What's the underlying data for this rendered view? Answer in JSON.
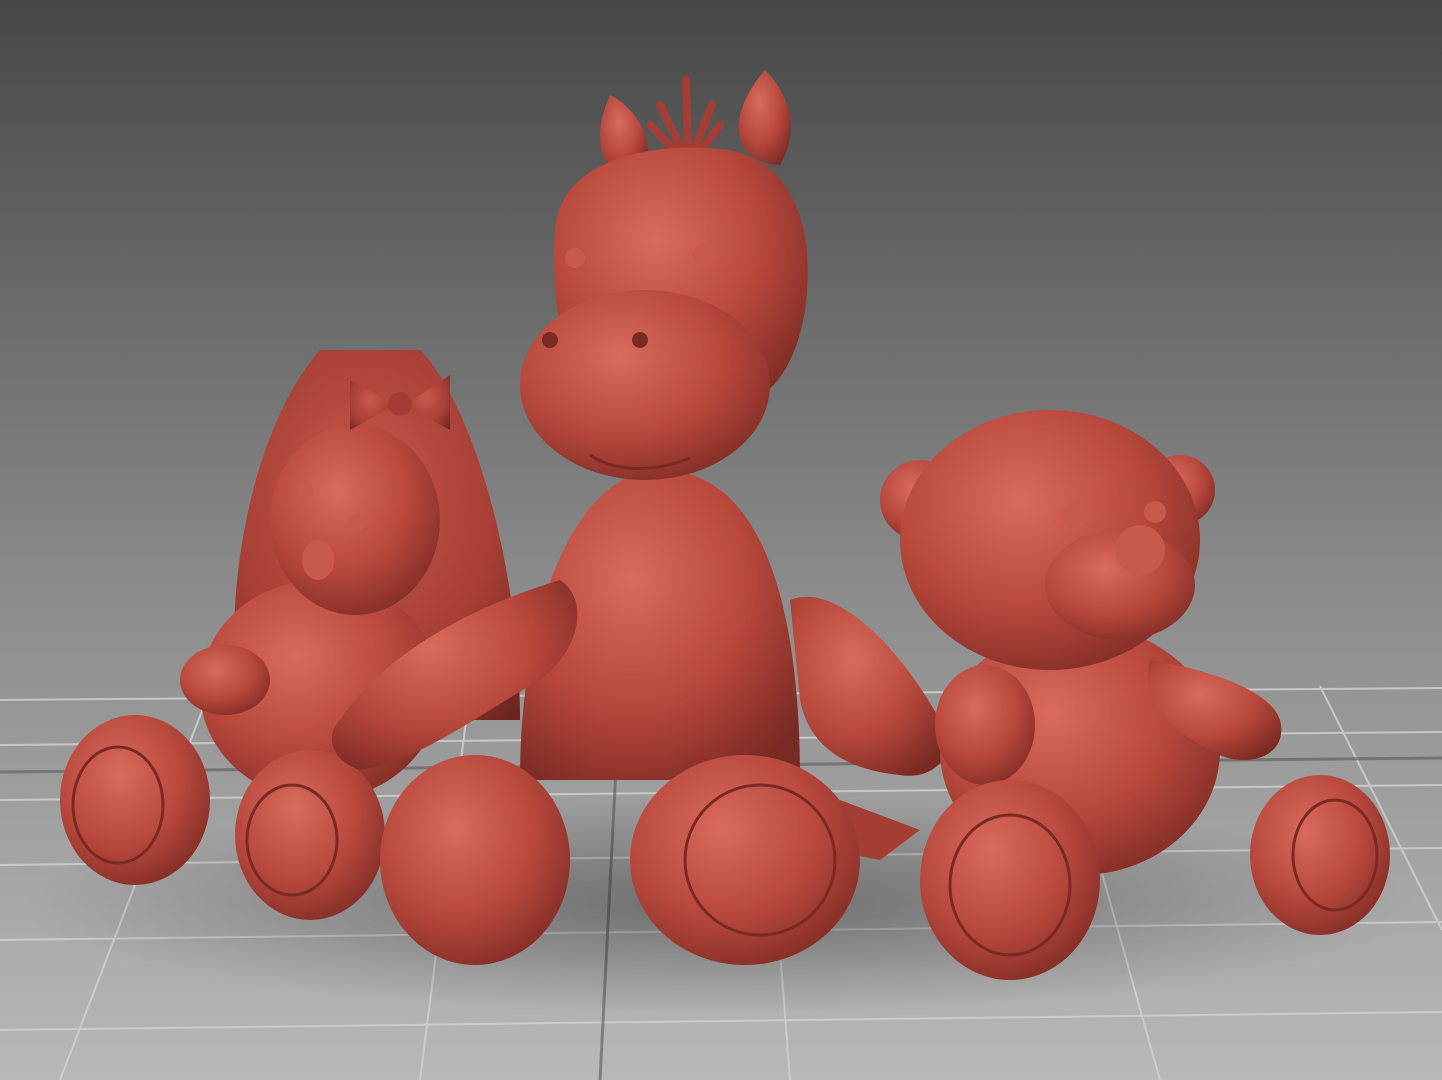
{
  "viewport": {
    "background_top": "#474747",
    "background_bottom": "#b1b1b1",
    "grid_line_color": "#c9c9c9",
    "grid_line_dark": "#8f8f8f"
  },
  "scene": {
    "material_color": "#b9483c",
    "material_highlight": "#d96a5c",
    "material_shadow": "#7a2a24",
    "objects": [
      {
        "kind": "bunny-plush",
        "color": "#b64a3e"
      },
      {
        "kind": "horse-plush",
        "color": "#bc4b3f"
      },
      {
        "kind": "teddy-bear-plush",
        "color": "#b84a3e"
      }
    ]
  }
}
